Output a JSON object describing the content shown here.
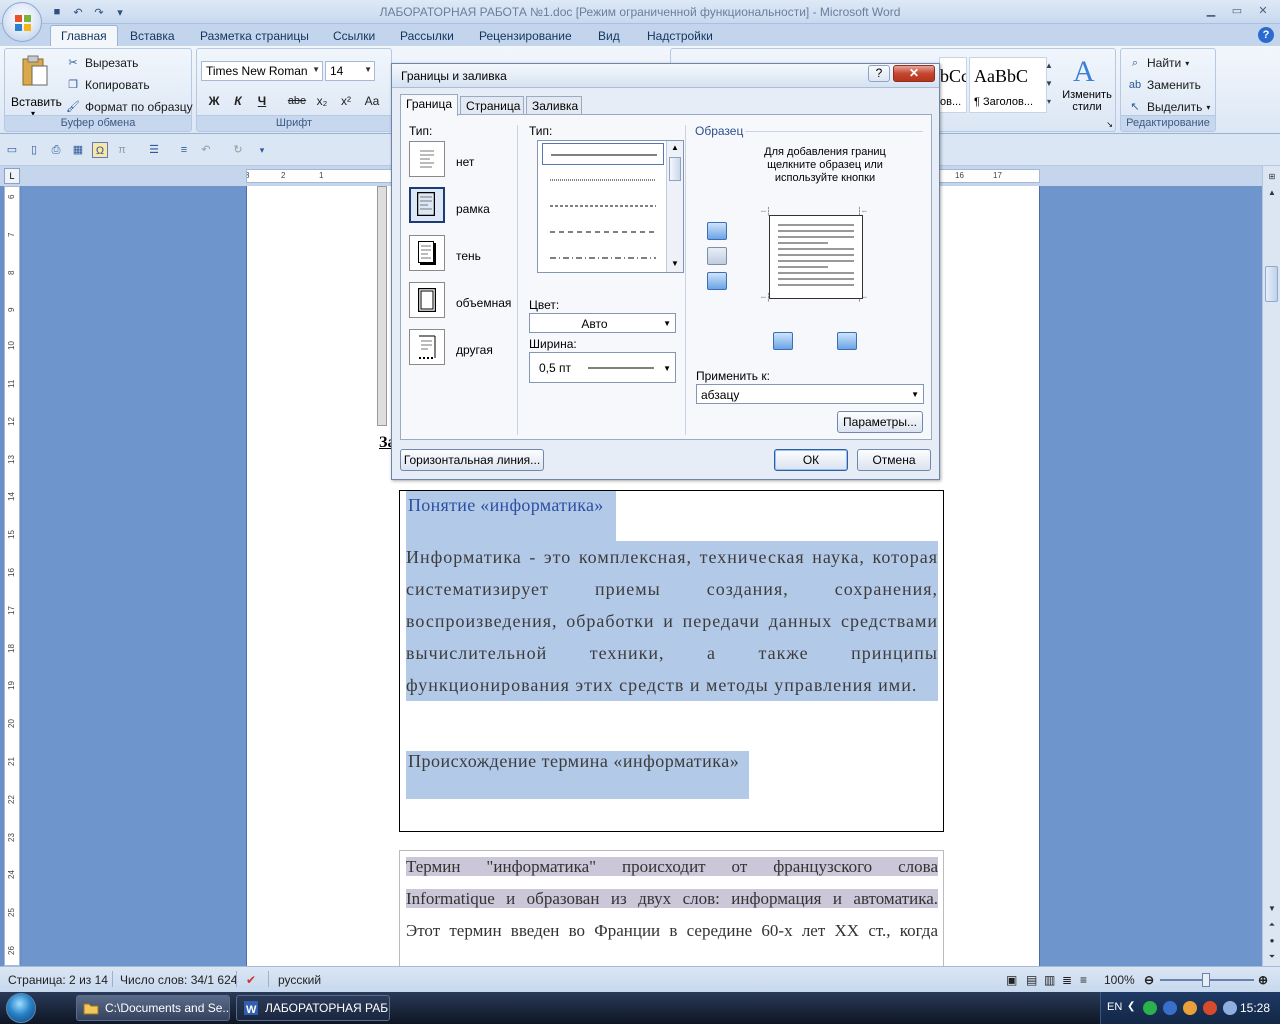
{
  "window": {
    "title": "ЛАБОРАТОРНАЯ РАБОТА №1.doc [Режим ограниченной функциональности] - Microsoft Word"
  },
  "ribbon": {
    "tabs": [
      "Главная",
      "Вставка",
      "Разметка страницы",
      "Ссылки",
      "Рассылки",
      "Рецензирование",
      "Вид",
      "Надстройки"
    ],
    "clipboard": {
      "paste": "Вставить",
      "cut": "Вырезать",
      "copy": "Копировать",
      "format_painter": "Формат по образцу",
      "label": "Буфер обмена"
    },
    "font": {
      "name": "Times New Roman",
      "size": "14",
      "label": "Шрифт",
      "buttons": [
        "Ж",
        "К",
        "Ч",
        "abe",
        "x₂",
        "x²",
        "Aa"
      ]
    },
    "styles": {
      "items": [
        {
          "sample": "bCc",
          "name": "ов..."
        },
        {
          "sample": "AaBbC",
          "name": "¶ Заголов..."
        }
      ],
      "change_styles": "Изменить стили"
    },
    "editing": {
      "find": "Найти",
      "replace": "Заменить",
      "select": "Выделить",
      "label": "Редактирование"
    }
  },
  "ruler": {
    "labels": [
      "3",
      "2",
      "1",
      "16",
      "17"
    ]
  },
  "vruler": {
    "labels": [
      "6",
      "7",
      "8",
      "9",
      "10",
      "11",
      "12",
      "13",
      "14",
      "15",
      "16",
      "17",
      "18",
      "19",
      "20",
      "21",
      "22",
      "23",
      "24",
      "25",
      "26"
    ]
  },
  "document": {
    "partial_label": "За",
    "heading": "Понятие «информатика»",
    "body": "Информатика - это комплексная, техническая наука, которая систематизирует приемы создания, сохранения, воспроизведения, обработки и передачи данных средствами вычислительной техники, а также принципы функционирования этих средств и методы управления ими.",
    "origin_heading": "Происхождение термина «информатика»",
    "para2_lines": [
      "Термин \"информатика\" происходит от французского слова",
      "Informatique и образован из двух слов: информация и автоматика.",
      "Этот термин введен во Франции в середине 60-х лет XX ст., когда"
    ]
  },
  "dialog": {
    "title": "Границы и заливка",
    "help": "?",
    "close": "✕",
    "tabs": [
      "Граница",
      "Страница",
      "Заливка"
    ],
    "type_label": "Тип:",
    "types": [
      "нет",
      "рамка",
      "тень",
      "объемная",
      "другая"
    ],
    "style_label": "Тип:",
    "color_label": "Цвет:",
    "color_value": "Авто",
    "width_label": "Ширина:",
    "width_value": "0,5 пт",
    "preview_label": "Образец",
    "preview_hint": "Для добавления границ щелкните образец или используйте кнопки",
    "apply_label": "Применить к:",
    "apply_value": "абзацу",
    "options_button": "Параметры...",
    "horizontal_line_button": "Горизонтальная линия...",
    "ok_button": "ОК",
    "cancel_button": "Отмена"
  },
  "statusbar": {
    "page": "Страница: 2 из 14",
    "words": "Число слов: 34/1 624",
    "language": "русский",
    "zoom": "100%"
  },
  "taskbar": {
    "tasks": [
      "C:\\Documents and Se...",
      "ЛАБОРАТОРНАЯ РАБ..."
    ],
    "lang": "EN",
    "clock": "15:28"
  }
}
